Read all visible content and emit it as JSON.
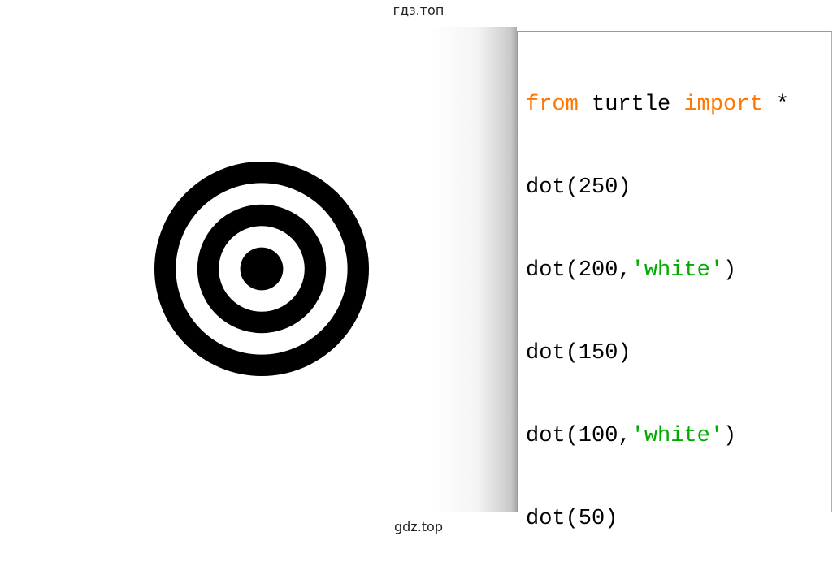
{
  "watermarks": {
    "top": "гдз.топ",
    "bottom": "gdz.top"
  },
  "colors": {
    "keyword": "#ff7700",
    "string": "#00aa00",
    "ink": "#000000",
    "paper": "#ffffff"
  },
  "turtle_canvas": {
    "dots": [
      {
        "size": 250,
        "color": "black"
      },
      {
        "size": 200,
        "color": "white"
      },
      {
        "size": 150,
        "color": "black"
      },
      {
        "size": 100,
        "color": "white"
      },
      {
        "size": 50,
        "color": "black"
      }
    ]
  },
  "code": {
    "line1": {
      "kw1": "from",
      "mid": " turtle ",
      "kw2": "import",
      "rest": " *"
    },
    "line2": {
      "text": "dot(250)"
    },
    "line3": {
      "pre": "dot(200,",
      "str": "'white'",
      "post": ")"
    },
    "line4": {
      "text": "dot(150)"
    },
    "line5": {
      "pre": "dot(100,",
      "str": "'white'",
      "post": ")"
    },
    "line6": {
      "text": "dot(50)"
    }
  }
}
